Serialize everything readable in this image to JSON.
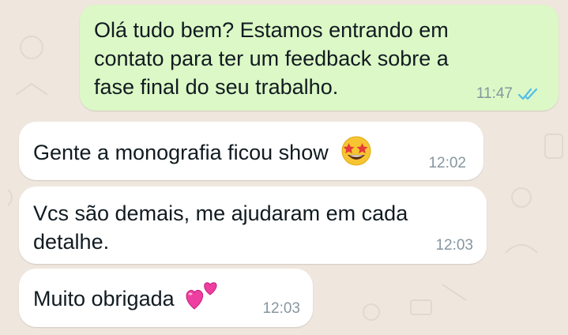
{
  "messages": [
    {
      "direction": "outgoing",
      "text": "Olá tudo bem? Estamos entrando em\ncontato para ter um feedback sobre a\nfase final do seu trabalho.",
      "time": "11:47",
      "status_icon": "double-check-read-icon"
    },
    {
      "direction": "incoming",
      "text": "Gente a monografia ficou show",
      "emoji": "star-struck-emoji",
      "time": "12:02"
    },
    {
      "direction": "incoming",
      "text": "Vcs são demais, me ajudaram em cada\ndetalhe.",
      "time": "12:03"
    },
    {
      "direction": "incoming",
      "text": "Muito obrigada",
      "emoji": "two-hearts-emoji",
      "time": "12:03"
    }
  ],
  "colors": {
    "background": "#efe7de",
    "outgoing_bubble": "#dcf8c6",
    "incoming_bubble": "#ffffff",
    "timestamp": "#8696a0",
    "read_ticks": "#53bdeb"
  }
}
